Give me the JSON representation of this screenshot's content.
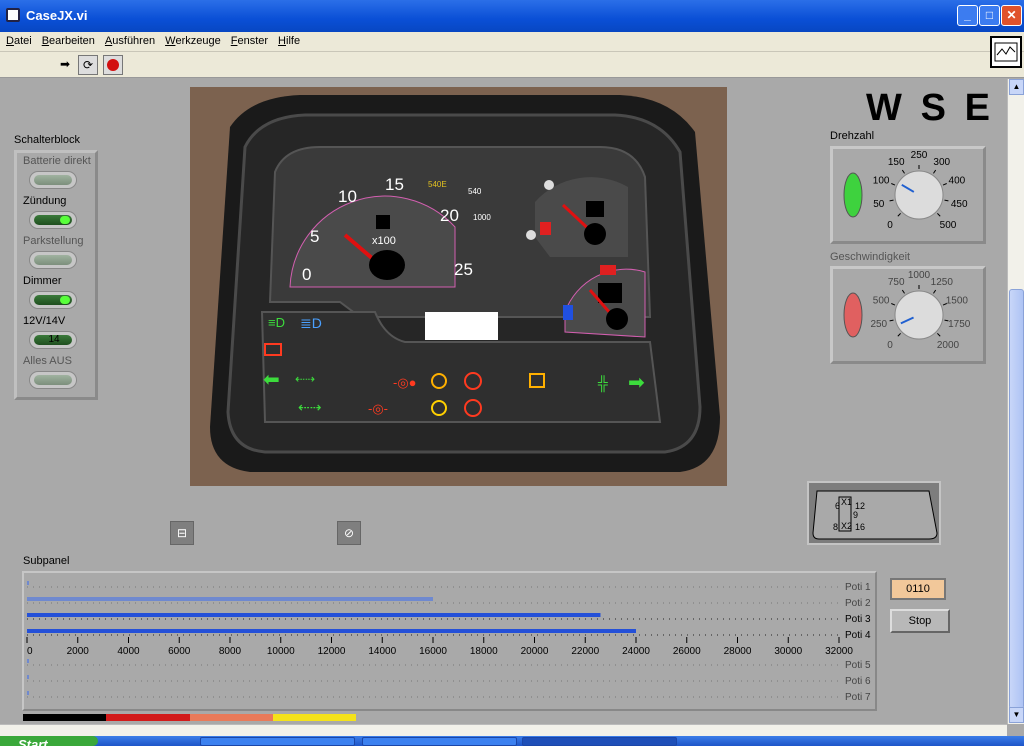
{
  "window": {
    "title": "CaseJX.vi"
  },
  "menu": {
    "items": [
      {
        "pre": "",
        "u": "D",
        "post": "atei"
      },
      {
        "pre": "",
        "u": "B",
        "post": "earbeiten"
      },
      {
        "pre": "",
        "u": "A",
        "post": "usführen"
      },
      {
        "pre": "",
        "u": "W",
        "post": "erkzeuge"
      },
      {
        "pre": "",
        "u": "F",
        "post": "enster"
      },
      {
        "pre": "",
        "u": "H",
        "post": "ilfe"
      }
    ]
  },
  "schalterblock": {
    "title": "Schalterblock",
    "switches": [
      {
        "label": "Batterie direkt",
        "state": "off",
        "enabled": false
      },
      {
        "label": "Zündung",
        "state": "on",
        "enabled": true
      },
      {
        "label": "Parkstellung",
        "state": "off",
        "enabled": false
      },
      {
        "label": "Dimmer",
        "state": "on",
        "enabled": true
      },
      {
        "label": "12V/14V",
        "state": "on",
        "enabled": true,
        "value": "14"
      },
      {
        "label": "Alles AUS",
        "state": "off",
        "enabled": false
      }
    ]
  },
  "dashboard": {
    "tacho_ticks": [
      "0",
      "5",
      "10",
      "15",
      "20",
      "25"
    ],
    "tacho_unit": "x100",
    "pto_540e": "540E",
    "pto_540": "540",
    "pto_1000": "1000",
    "colors": {
      "needle": "#e01010",
      "green": "#3cdc3c",
      "amber": "#ffb000",
      "red": "#ff3a20",
      "blue": "#4aa0ff"
    }
  },
  "logo": {
    "text": "WSE"
  },
  "drehzahl": {
    "title": "Drehzahl",
    "ticks": [
      "0",
      "50",
      "100",
      "150",
      "250",
      "300",
      "400",
      "450",
      "500"
    ],
    "value": 140,
    "max": 500,
    "led": "green"
  },
  "geschwindigkeit": {
    "title": "Geschwindigkeit",
    "ticks": [
      "0",
      "250",
      "500",
      "750",
      "1000",
      "1250",
      "1500",
      "1750",
      "2000"
    ],
    "value": 150,
    "max": 2000,
    "led": "red",
    "enabled": false
  },
  "gear_display": {
    "labels": [
      "6",
      "X1",
      "12",
      "9",
      "8",
      "X2",
      "16"
    ]
  },
  "buttons": {
    "gearbox_icon": "gearbox-icon",
    "oil_icon": "oil-pressure-icon"
  },
  "subpanel": {
    "title": "Subpanel",
    "scale": [
      "0",
      "2000",
      "4000",
      "6000",
      "8000",
      "10000",
      "12000",
      "14000",
      "16000",
      "18000",
      "20000",
      "22000",
      "24000",
      "26000",
      "28000",
      "30000",
      "32000"
    ],
    "max": 32000,
    "sliders": [
      {
        "name": "Poti 1",
        "value": 0,
        "dim": true
      },
      {
        "name": "Poti 2",
        "value": 16000,
        "dim": true
      },
      {
        "name": "Poti 3",
        "value": 22600,
        "dim": false
      },
      {
        "name": "Poti 4",
        "value": 24000,
        "dim": false
      },
      {
        "name": "Poti 5",
        "value": 0,
        "dim": true
      },
      {
        "name": "Poti 6",
        "value": 0,
        "dim": true
      },
      {
        "name": "Poti 7",
        "value": 0,
        "dim": true
      }
    ]
  },
  "status_value": "0110",
  "stop_label": "Stop",
  "taskbar": {
    "start": "Start"
  }
}
